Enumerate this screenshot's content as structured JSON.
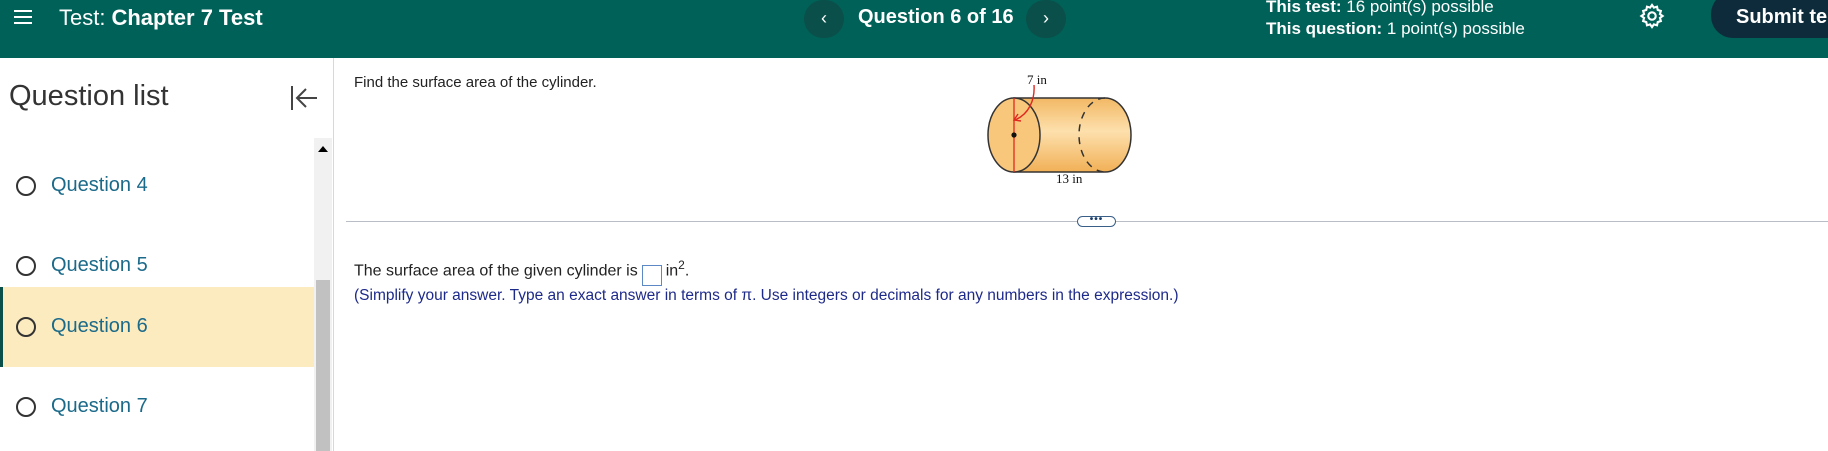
{
  "header": {
    "test_prefix": "Test:",
    "test_name": "Chapter 7 Test",
    "question_counter": "Question 6 of 16",
    "prev_symbol": "‹",
    "next_symbol": "›",
    "this_test_label": "This test:",
    "this_test_value": "16 point(s) possible",
    "this_question_label": "This question:",
    "this_question_value": "1 point(s) possible",
    "submit_label": "Submit te"
  },
  "sidebar": {
    "title": "Question list",
    "items": [
      {
        "label": "Question 4",
        "active": false
      },
      {
        "label": "Question 5",
        "active": false
      },
      {
        "label": "Question 6",
        "active": true
      },
      {
        "label": "Question 7",
        "active": false
      }
    ]
  },
  "question": {
    "prompt": "Find the surface area of the cylinder.",
    "figure": {
      "radius_label": "7 in",
      "length_label": "13 in"
    },
    "answer_prefix": "The surface area of the given cylinder is",
    "answer_value": "",
    "answer_unit": "in",
    "answer_unit_exponent": "2",
    "answer_suffix": ".",
    "hint": "(Simplify your answer. Type an exact answer in terms of π. Use integers or decimals for any numbers in the expression.)",
    "handle_dots": "•••"
  },
  "colors": {
    "header_bg": "#006158",
    "active_item_bg": "#fbebbf",
    "link_text": "#1b6a8a",
    "hint_text": "#1e2a8a"
  },
  "icons": {
    "menu": "hamburger-icon",
    "settings": "gear-icon",
    "collapse": "collapse-left-icon"
  }
}
